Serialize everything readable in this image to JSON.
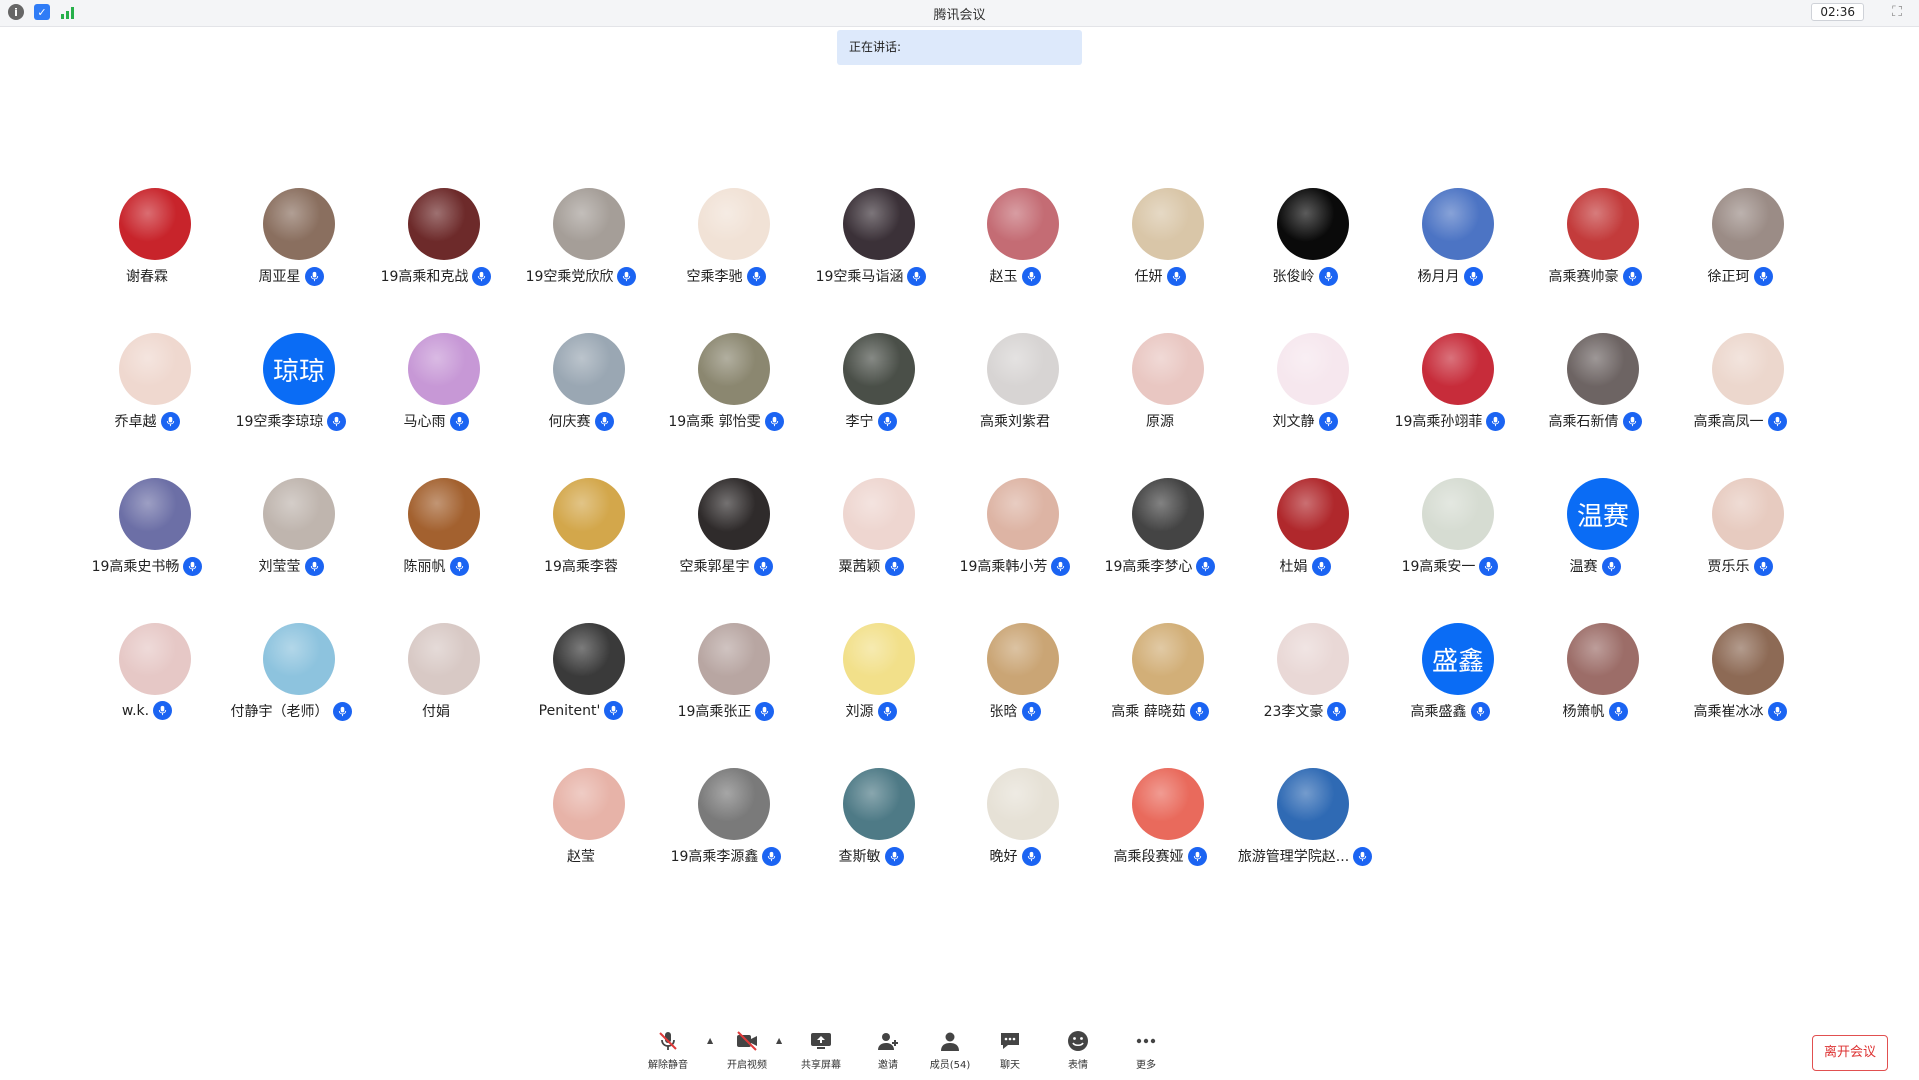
{
  "window": {
    "title": "腾讯会议",
    "clock": "02:36"
  },
  "speaking": {
    "label": "正在讲话:"
  },
  "participants": [
    {
      "name": "谢春霖",
      "mic": false,
      "avatar": "photo",
      "color": "#c8242b"
    },
    {
      "name": "周亚星",
      "mic": true,
      "avatar": "photo",
      "color": "#8a6f5f"
    },
    {
      "name": "19高乘和克战",
      "mic": true,
      "avatar": "photo",
      "color": "#6d2a2a"
    },
    {
      "name": "19空乘党欣欣",
      "mic": true,
      "avatar": "photo",
      "color": "#a59e98"
    },
    {
      "name": "空乘李驰",
      "mic": true,
      "avatar": "photo",
      "color": "#f1e2d6"
    },
    {
      "name": "19空乘马诣涵",
      "mic": true,
      "avatar": "photo",
      "color": "#3b3138"
    },
    {
      "name": "赵玉",
      "mic": true,
      "avatar": "photo",
      "color": "#c46c74"
    },
    {
      "name": "任妍",
      "mic": true,
      "avatar": "photo",
      "color": "#d9c6a8"
    },
    {
      "name": "张俊岭",
      "mic": true,
      "avatar": "photo",
      "color": "#0a0a0a"
    },
    {
      "name": "杨月月",
      "mic": true,
      "avatar": "photo",
      "color": "#4c74c4"
    },
    {
      "name": "高乘赛帅豪",
      "mic": true,
      "avatar": "photo",
      "color": "#c33b3b"
    },
    {
      "name": "徐正珂",
      "mic": true,
      "avatar": "photo",
      "color": "#9b8c86"
    },
    {
      "name": "乔卓越",
      "mic": true,
      "avatar": "photo",
      "color": "#efd8cf"
    },
    {
      "name": "19空乘李琼琼",
      "mic": true,
      "avatar": "text",
      "text": "琼琼"
    },
    {
      "name": "马心雨",
      "mic": true,
      "avatar": "photo",
      "color": "#c798d6"
    },
    {
      "name": "何庆赛",
      "mic": true,
      "avatar": "photo",
      "color": "#9aa7b3"
    },
    {
      "name": "19高乘 郭怡雯",
      "mic": true,
      "avatar": "photo",
      "color": "#8b8770"
    },
    {
      "name": "李宁",
      "mic": true,
      "avatar": "photo",
      "color": "#4a4f48"
    },
    {
      "name": "高乘刘紫君",
      "mic": false,
      "avatar": "photo",
      "color": "#d7d4d3"
    },
    {
      "name": "原源",
      "mic": false,
      "avatar": "photo",
      "color": "#e9c7c2"
    },
    {
      "name": "刘文静",
      "mic": true,
      "avatar": "photo",
      "color": "#f6e7ee"
    },
    {
      "name": "19高乘孙翊菲",
      "mic": true,
      "avatar": "photo",
      "color": "#c72c3a"
    },
    {
      "name": "高乘石新倩",
      "mic": true,
      "avatar": "photo",
      "color": "#6d6463"
    },
    {
      "name": "高乘高凤一",
      "mic": true,
      "avatar": "photo",
      "color": "#ecd7cd"
    },
    {
      "name": "19高乘史书畅",
      "mic": true,
      "avatar": "photo",
      "color": "#6c6fa6"
    },
    {
      "name": "刘莹莹",
      "mic": true,
      "avatar": "photo",
      "color": "#bfb5ae"
    },
    {
      "name": "陈丽帆",
      "mic": true,
      "avatar": "photo",
      "color": "#a3612f"
    },
    {
      "name": "19高乘李蓉",
      "mic": false,
      "avatar": "photo",
      "color": "#d3a74b"
    },
    {
      "name": "空乘郭星宇",
      "mic": true,
      "avatar": "photo",
      "color": "#2f2b2b"
    },
    {
      "name": "粟茜颖",
      "mic": true,
      "avatar": "photo",
      "color": "#eed6d0"
    },
    {
      "name": "19高乘韩小芳",
      "mic": true,
      "avatar": "photo",
      "color": "#ddb4a4"
    },
    {
      "name": "19高乘李梦心",
      "mic": true,
      "avatar": "photo",
      "color": "#444444"
    },
    {
      "name": "杜娟",
      "mic": true,
      "avatar": "photo",
      "color": "#b0282c"
    },
    {
      "name": "19高乘安一",
      "mic": true,
      "avatar": "photo",
      "color": "#d6dcd2"
    },
    {
      "name": "温赛",
      "mic": true,
      "avatar": "text",
      "text": "温赛"
    },
    {
      "name": "贾乐乐",
      "mic": true,
      "avatar": "photo",
      "color": "#e7cbc0"
    },
    {
      "name": "w.k.",
      "mic": true,
      "avatar": "photo",
      "color": "#e6c8c6"
    },
    {
      "name": "付静宇（老师）",
      "mic": true,
      "avatar": "photo",
      "color": "#8dc3de"
    },
    {
      "name": "付娟",
      "mic": false,
      "avatar": "photo",
      "color": "#d8c9c5"
    },
    {
      "name": "Penitent'",
      "mic": true,
      "avatar": "photo",
      "color": "#3a3a3a"
    },
    {
      "name": "19高乘张正",
      "mic": true,
      "avatar": "photo",
      "color": "#b8a6a2"
    },
    {
      "name": "刘源",
      "mic": true,
      "avatar": "photo",
      "color": "#f2e08a"
    },
    {
      "name": "张晗",
      "mic": true,
      "avatar": "photo",
      "color": "#caa575"
    },
    {
      "name": "高乘 薛晓茹",
      "mic": true,
      "avatar": "photo",
      "color": "#d2af78"
    },
    {
      "name": "23李文豪",
      "mic": true,
      "avatar": "photo",
      "color": "#e9d8d6"
    },
    {
      "name": "高乘盛鑫",
      "mic": true,
      "avatar": "text",
      "text": "盛鑫"
    },
    {
      "name": "杨箫帆",
      "mic": true,
      "avatar": "photo",
      "color": "#9c6d68"
    },
    {
      "name": "高乘崔冰冰",
      "mic": true,
      "avatar": "photo",
      "color": "#8d6a55"
    },
    {
      "name": "赵莹",
      "mic": false,
      "avatar": "photo",
      "color": "#e7b3a8"
    },
    {
      "name": "19高乘李源鑫",
      "mic": true,
      "avatar": "photo",
      "color": "#7a7a7a"
    },
    {
      "name": "查斯敏",
      "mic": true,
      "avatar": "photo",
      "color": "#4e7a86"
    },
    {
      "name": "晚好",
      "mic": true,
      "avatar": "photo",
      "color": "#e6e1d6"
    },
    {
      "name": "高乘段赛娅",
      "mic": true,
      "avatar": "photo",
      "color": "#e96a5c"
    },
    {
      "name": "旅游管理学院赵...",
      "mic": true,
      "avatar": "photo",
      "color": "#2f6ab4"
    }
  ],
  "toolbar": {
    "unmute": "解除静音",
    "video": "开启视频",
    "share": "共享屏幕",
    "invite": "邀请",
    "members": "成员(54)",
    "chat": "聊天",
    "emoji": "表情",
    "more": "更多",
    "leave": "离开会议"
  },
  "colors": {
    "accent": "#1b64f2",
    "speaking_bg": "#dde9fb",
    "leave_red": "#e15050"
  }
}
